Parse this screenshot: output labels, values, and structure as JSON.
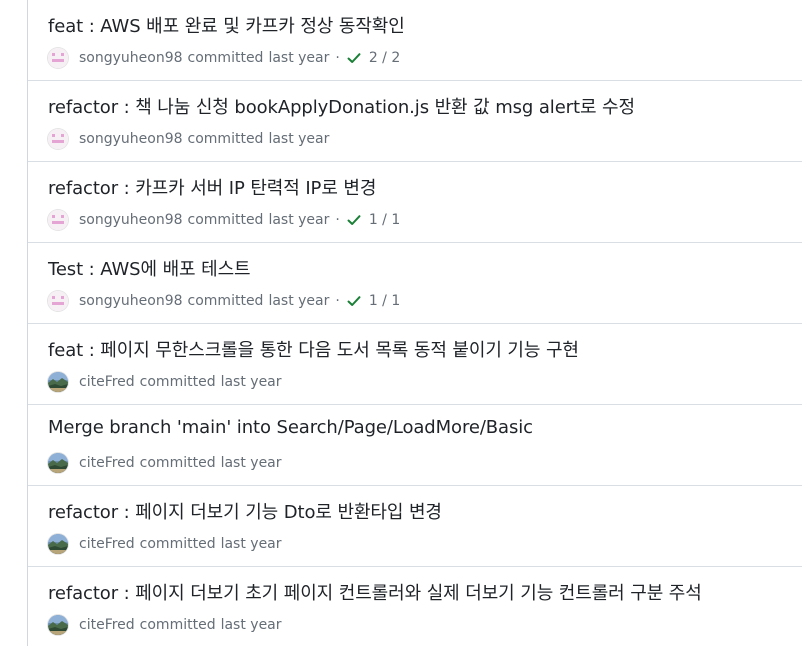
{
  "commits": [
    {
      "title": "feat : AWS 배포 완료 및 카프카 정상 동작확인",
      "author": "songyuheon98",
      "action": "committed",
      "time": "last year",
      "checks": "2 / 2",
      "avatar": "songyuheon98"
    },
    {
      "title": "refactor : 책 나눔 신청 bookApplyDonation.js 반환 값 msg alert로 수정",
      "author": "songyuheon98",
      "action": "committed",
      "time": "last year",
      "checks": null,
      "avatar": "songyuheon98"
    },
    {
      "title": "refactor : 카프카 서버 IP 탄력적 IP로 변경",
      "author": "songyuheon98",
      "action": "committed",
      "time": "last year",
      "checks": "1 / 1",
      "avatar": "songyuheon98"
    },
    {
      "title": "Test : AWS에 배포 테스트",
      "author": "songyuheon98",
      "action": "committed",
      "time": "last year",
      "checks": "1 / 1",
      "avatar": "songyuheon98"
    },
    {
      "title": "feat : 페이지 무한스크롤을 통한 다음 도서 목록 동적 붙이기 기능 구현",
      "author": "citeFred",
      "action": "committed",
      "time": "last year",
      "checks": null,
      "avatar": "citeFred"
    },
    {
      "title": "Merge branch 'main' into Search/Page/LoadMore/Basic",
      "author": "citeFred",
      "action": "committed",
      "time": "last year",
      "checks": null,
      "avatar": "citeFred"
    },
    {
      "title": "refactor : 페이지 더보기 기능 Dto로 반환타입 변경",
      "author": "citeFred",
      "action": "committed",
      "time": "last year",
      "checks": null,
      "avatar": "citeFred"
    },
    {
      "title": "refactor : 페이지 더보기 초기 페이지 컨트롤러와 실제 더보기 기능 컨트롤러 구분 주석",
      "author": "citeFred",
      "action": "committed",
      "time": "last year",
      "checks": null,
      "avatar": "citeFred"
    }
  ],
  "colors": {
    "check": "#1a7f37",
    "identicon_pink": "#e4a5d4",
    "meta_text": "#656d76",
    "title_text": "#1f2328"
  },
  "icons": {
    "check": "check-icon",
    "avatar_songyuheon98": "identicon-avatar",
    "avatar_citeFred": "landscape-photo-avatar"
  }
}
